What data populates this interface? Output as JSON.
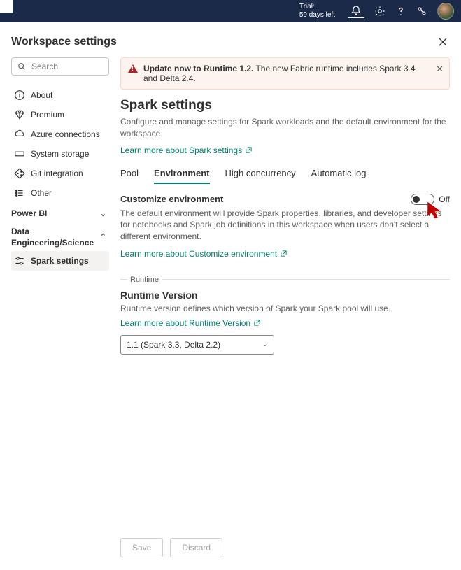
{
  "topbar": {
    "trial_line1": "Trial:",
    "trial_line2": "59 days left"
  },
  "page_title": "Workspace settings",
  "search": {
    "placeholder": "Search"
  },
  "sidebar": {
    "items": [
      {
        "label": "About"
      },
      {
        "label": "Premium"
      },
      {
        "label": "Azure connections"
      },
      {
        "label": "System storage"
      },
      {
        "label": "Git integration"
      },
      {
        "label": "Other"
      }
    ],
    "group1": {
      "label": "Power BI"
    },
    "group2": {
      "line1": "Data",
      "line2": "Engineering/Science"
    },
    "spark_settings": "Spark settings"
  },
  "alert": {
    "bold": "Update now to Runtime 1.2.",
    "rest": " The new Fabric runtime includes Spark 3.4 and Delta 2.4."
  },
  "spark": {
    "title": "Spark settings",
    "desc": "Configure and manage settings for Spark workloads and the default environment for the workspace.",
    "link": "Learn more about Spark settings"
  },
  "tabs": {
    "pool": "Pool",
    "environment": "Environment",
    "high_concurrency": "High concurrency",
    "automatic_log": "Automatic log"
  },
  "customize": {
    "title": "Customize environment",
    "toggle_label": "Off",
    "desc": "The default environment will provide Spark properties, libraries, and developer settings for notebooks and Spark job definitions in this workspace when users don't select a different environment.",
    "link": "Learn more about Customize environment"
  },
  "runtime": {
    "legend": "Runtime",
    "title": "Runtime Version",
    "desc": "Runtime version defines which version of Spark your Spark pool will use.",
    "link": "Learn more about Runtime Version",
    "selected": "1.1 (Spark 3.3, Delta 2.2)"
  },
  "footer": {
    "save": "Save",
    "discard": "Discard"
  }
}
